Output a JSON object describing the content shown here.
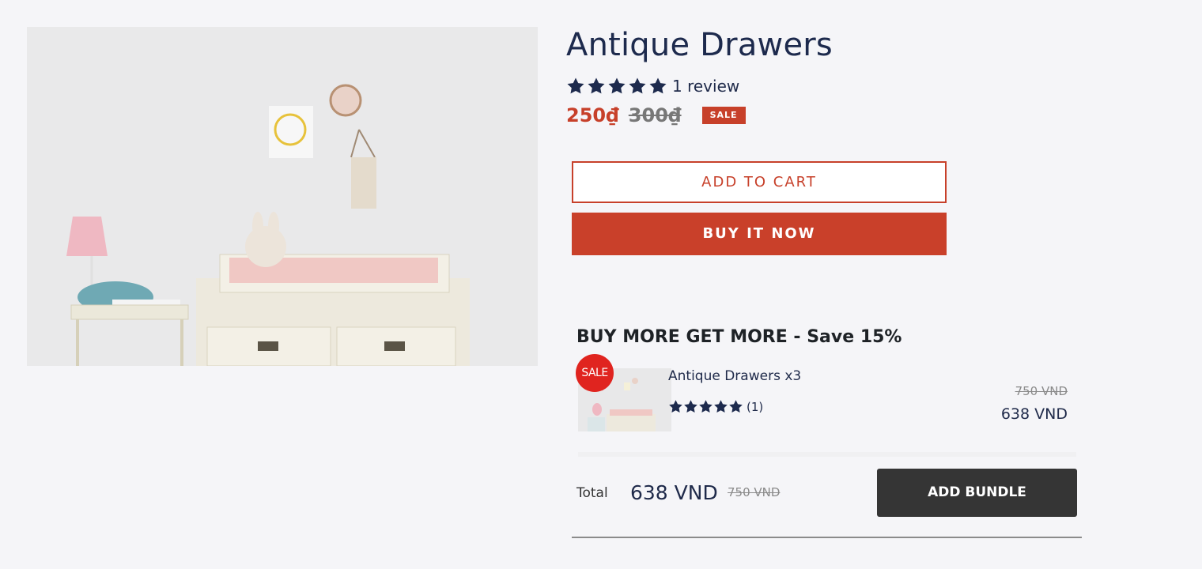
{
  "product": {
    "title": "Antique Drawers",
    "rating": 5,
    "review_text": "1 review",
    "price": "250₫",
    "compare_price": "300₫",
    "sale_badge": "SALE"
  },
  "actions": {
    "add_to_cart": "ADD TO CART",
    "buy_now": "BUY IT NOW"
  },
  "bundle": {
    "heading": "BUY MORE GET MORE - Save 15%",
    "sale_badge": "SALE",
    "item_name": "Antique Drawers x3",
    "item_rating": 5,
    "item_review_count": "(1)",
    "item_old_price": "750 VND",
    "item_price": "638 VND",
    "total_label": "Total",
    "total_value": "638 VND",
    "total_old": "750 VND",
    "add_bundle": "ADD BUNDLE"
  },
  "colors": {
    "accent": "#c9402a",
    "navy": "#1d2a4d",
    "dark_button": "#353535",
    "sale_circle": "#e0241f"
  }
}
